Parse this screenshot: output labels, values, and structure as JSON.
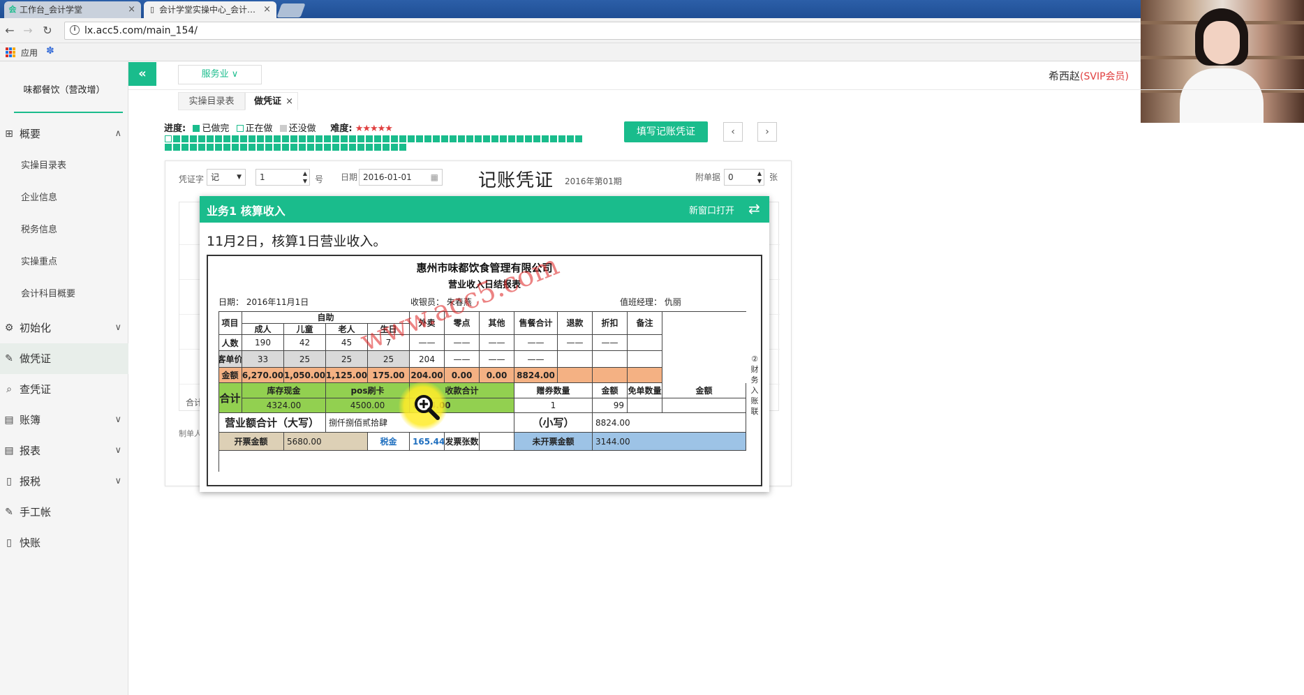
{
  "browser": {
    "tabs": [
      {
        "title": "工作台_会计学堂",
        "icon": "会"
      },
      {
        "title": "会计学堂实操中心_会计…",
        "icon": "▯"
      }
    ],
    "url": "lx.acc5.com/main_154/",
    "bookmarks_apps": "应用"
  },
  "sidebar": {
    "company": "味都餐饮（营改增）",
    "items": [
      {
        "label": "概要",
        "icon": "grid-icon",
        "glyph": "⊞",
        "chev": "∧"
      },
      {
        "label": "初始化",
        "icon": "gear-icon",
        "glyph": "⚙",
        "chev": "∨"
      },
      {
        "label": "做凭证",
        "icon": "pen-icon",
        "glyph": "✎",
        "chev": ""
      },
      {
        "label": "查凭证",
        "icon": "search-icon",
        "glyph": "⌕",
        "chev": ""
      },
      {
        "label": "账簿",
        "icon": "book-icon",
        "glyph": "▤",
        "chev": "∨"
      },
      {
        "label": "报表",
        "icon": "report-icon",
        "glyph": "▤",
        "chev": "∨"
      },
      {
        "label": "报税",
        "icon": "file-icon",
        "glyph": "▯",
        "chev": "∨"
      },
      {
        "label": "手工帐",
        "icon": "pen-icon",
        "glyph": "✎",
        "chev": ""
      },
      {
        "label": "快账",
        "icon": "file-icon",
        "glyph": "▯",
        "chev": ""
      }
    ],
    "subitems": [
      "实操目录表",
      "企业信息",
      "税务信息",
      "实操重点",
      "会计科目概要"
    ]
  },
  "topbar": {
    "collapse": "«",
    "industry": "服务业 ∨",
    "user": "希西赵",
    "vip": "(SVIP会员)"
  },
  "page_tabs": {
    "tab1": "实操目录表",
    "tab2": "做凭证",
    "close": "×"
  },
  "progress": {
    "label": "进度:",
    "done": "已做完",
    "doing": "正在做",
    "todo": "还没做",
    "difficulty_label": "难度:",
    "stars": "★★★★★",
    "total_cells": 79,
    "first_row_cells": 50
  },
  "actions": {
    "fill": "填写记账凭证",
    "prev": "‹",
    "next": "›"
  },
  "voucher": {
    "word_label": "凭证字",
    "word_value": "记",
    "number_value": "1",
    "number_unit": "号",
    "date_label": "日期",
    "date_value": "2016-01-01",
    "title": "记账凭证",
    "period": "2016年第01期",
    "attach_label": "附单据",
    "attach_value": "0",
    "attach_unit": "张",
    "total": "合计",
    "maker": "制单人"
  },
  "task": {
    "title": "业务1 核算收入",
    "open_new": "新窗口打开",
    "description": "11月2日，核算1日营业收入。"
  },
  "report": {
    "company": "惠州市味都饮食管理有限公司",
    "name": "营业收入日结报表",
    "date": "日期：  2016年11月1日",
    "cashier": "收银员：  朱春燕",
    "manager": "值班经理：  仇丽",
    "side_note": "②财务入账联",
    "h_item": "项目",
    "h_buffet": "自助",
    "h_adult": "成人",
    "h_child": "儿童",
    "h_elder": "老人",
    "h_birthday": "生日",
    "h_takeout": "外卖",
    "h_snack": "零点",
    "h_other": "其他",
    "h_sales_total": "售餐合计",
    "h_refund": "退款",
    "h_discount": "折扣",
    "h_note": "备注",
    "r_count": "人数",
    "r_price": "客单价",
    "r_amount": "金额",
    "count": {
      "adult": "190",
      "child": "42",
      "elder": "45",
      "birthday": "7",
      "takeout": "——",
      "snack": "——",
      "other": "——",
      "sales_total": "——",
      "refund": "——",
      "discount": "——"
    },
    "price": {
      "adult": "33",
      "child": "25",
      "elder": "25",
      "birthday": "25",
      "takeout": "204",
      "snack": "——",
      "other": "——",
      "sales_total": "——"
    },
    "amount": {
      "adult": "6,270.00",
      "child": "1,050.00",
      "elder": "1,125.00",
      "birthday": "175.00",
      "takeout": "204.00",
      "snack": "0.00",
      "other": "0.00",
      "sales_total": "8824.00"
    },
    "sum_label": "合计",
    "h_cash": "库存现金",
    "h_pos": "pos刷卡",
    "h_collect_total": "收款合计",
    "h_coupon_qty": "赠券数量",
    "h_coupon_amt": "金额",
    "h_free_qty": "免单数量",
    "h_free_amt": "金额",
    "cash": "4324.00",
    "pos": "4500.00",
    "collect_total": "8824.00",
    "coupon_qty": "1",
    "coupon_amt": "99",
    "revenue_upper_label": "营业额合计（大写）",
    "revenue_upper": "捌仟捌佰贰拾肆",
    "revenue_lower_label": "（小写）",
    "revenue_lower": "8824.00",
    "invoice_label": "开票金额",
    "invoice": "5680.00",
    "tax_label": "税金",
    "tax": "165.44",
    "invoice_count_label": "发票张数",
    "uninvoiced_label": "未开票金额",
    "uninvoiced": "3144.00"
  },
  "watermark": "www.acc5.com",
  "colors": {
    "brand": "#1abc8c",
    "vip": "#e04040"
  }
}
